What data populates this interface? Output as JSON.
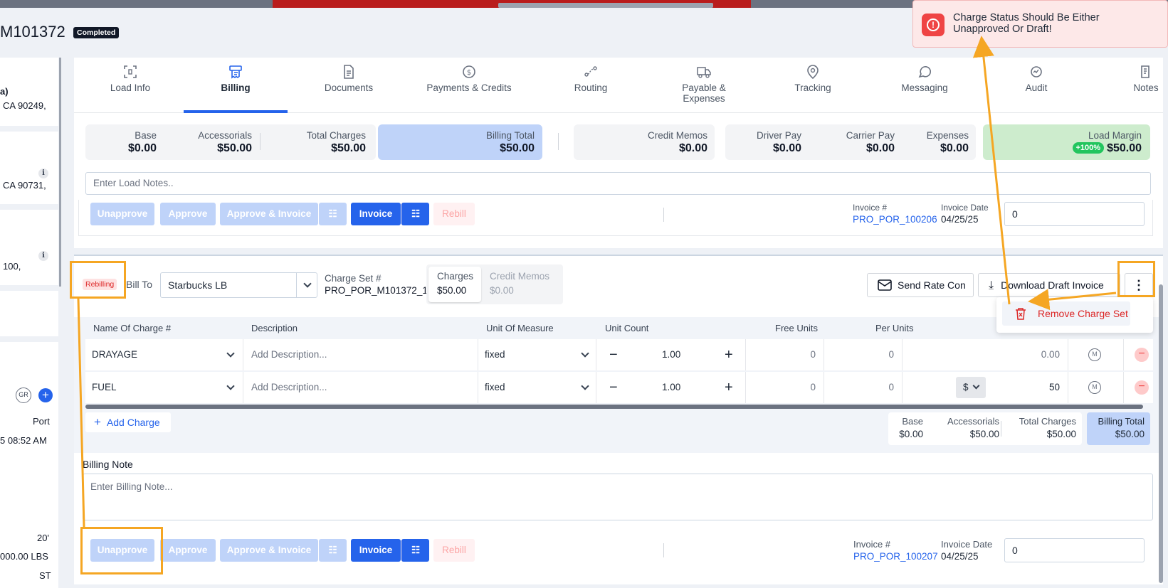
{
  "load": {
    "id": "M101372",
    "status": "Completed"
  },
  "left_panel": {
    "a_line": "a)",
    "addr1": "CA 90249,",
    "addr2": "CA 90731,",
    "addr3": "100,",
    "gr": "GR",
    "port": "Port",
    "time": "5 08:52 AM",
    "size": "20'",
    "weight": "000.00 LBS",
    "st": "ST"
  },
  "tabs": [
    {
      "label": "Load Info",
      "icon": "load-info-icon"
    },
    {
      "label": "Billing",
      "icon": "billing-icon",
      "active": true
    },
    {
      "label": "Documents",
      "icon": "documents-icon"
    },
    {
      "label": "Payments & Credits",
      "icon": "payments-icon"
    },
    {
      "label": "Routing",
      "icon": "routing-icon"
    },
    {
      "label": "Payable &",
      "label2": "Expenses",
      "icon": "truck-icon"
    },
    {
      "label": "Tracking",
      "icon": "tracking-icon"
    },
    {
      "label": "Messaging",
      "icon": "messaging-icon"
    },
    {
      "label": "Audit",
      "icon": "audit-icon"
    },
    {
      "label": "Notes",
      "icon": "notes-icon"
    }
  ],
  "summary": {
    "base_label": "Base",
    "base": "$0.00",
    "acc_label": "Accessorials",
    "acc": "$50.00",
    "total_label": "Total Charges",
    "total": "$50.00",
    "billing_label": "Billing Total",
    "billing": "$50.00",
    "credit_label": "Credit Memos",
    "credit": "$0.00",
    "driver_label": "Driver Pay",
    "driver": "$0.00",
    "carrier_label": "Carrier Pay",
    "carrier": "$0.00",
    "expenses_label": "Expenses",
    "expenses": "$0.00",
    "margin_label": "Load Margin",
    "margin_badge": "+100%",
    "margin": "$50.00"
  },
  "notes_placeholder": "Enter Load Notes..",
  "action_bar_1": {
    "unapprove": "Unapprove",
    "approve": "Approve",
    "approve_invoice": "Approve & Invoice",
    "invoice": "Invoice",
    "rebill": "Rebill",
    "invoice_no_label": "Invoice #",
    "invoice_no": "PRO_POR_100206",
    "invoice_date_label": "Invoice Date",
    "invoice_date": "04/25/25",
    "amount": "0"
  },
  "charge_set": {
    "rebilling": "Rebilling",
    "bill_to_label": "Bill To",
    "bill_to": "Starbucks LB",
    "charge_set_label": "Charge Set #",
    "charge_set_no": "PRO_POR_M101372_1",
    "charges_label": "Charges",
    "charges": "$50.00",
    "credit_memos_label": "Credit Memos",
    "credit_memos": "$0.00",
    "send_rate_con": "Send Rate Con",
    "download_draft": "Download Draft Invoice",
    "remove_charge_set": "Remove Charge Set"
  },
  "table": {
    "headers": [
      "Name Of Charge #",
      "Description",
      "Unit Of Measure",
      "Unit Count",
      "Free Units",
      "Per Units"
    ],
    "rows": [
      {
        "name": "DRAYAGE",
        "desc_placeholder": "Add Description...",
        "uom": "fixed",
        "count": "1.00",
        "free": "0",
        "per": "0",
        "currency": "",
        "amount": "0.00",
        "m": "M"
      },
      {
        "name": "FUEL",
        "desc_placeholder": "Add Description...",
        "uom": "fixed",
        "count": "1.00",
        "free": "0",
        "per": "0",
        "currency": "$",
        "amount": "50",
        "m": "M"
      }
    ]
  },
  "add_charge": "Add Charge",
  "totals": {
    "base_label": "Base",
    "base": "$0.00",
    "acc_label": "Accessorials",
    "acc": "$50.00",
    "total_label": "Total Charges",
    "total": "$50.00",
    "billing_label": "Billing Total",
    "billing": "$50.00"
  },
  "billing_note": {
    "label": "Billing Note",
    "placeholder": "Enter Billing Note..."
  },
  "action_bar_2": {
    "unapprove": "Unapprove",
    "approve": "Approve",
    "approve_invoice": "Approve & Invoice",
    "invoice": "Invoice",
    "rebill": "Rebill",
    "invoice_no_label": "Invoice #",
    "invoice_no": "PRO_POR_100207",
    "invoice_date_label": "Invoice Date",
    "invoice_date": "04/25/25",
    "amount": "0"
  },
  "toast": {
    "line1": "Charge Status Should Be Either",
    "line2": "Unapproved Or Draft!"
  },
  "colors": {
    "accent": "#2563eb",
    "error": "#ef4444",
    "highlight": "#f5a623",
    "success": "#22c55e"
  }
}
